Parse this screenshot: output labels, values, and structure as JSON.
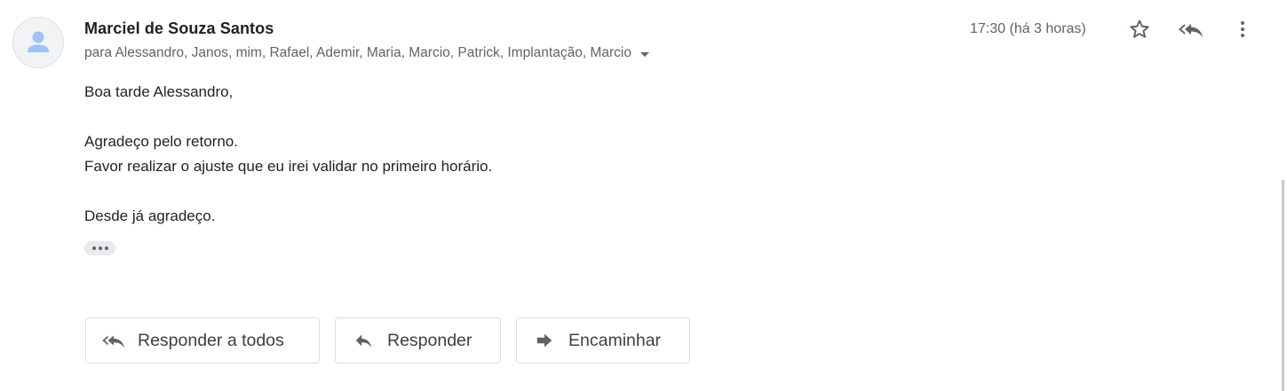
{
  "message": {
    "sender_name": "Marciel de Souza Santos",
    "recipients_text": "para Alessandro, Janos, mim, Rafael, Ademir, Maria, Marcio, Patrick, Implantação, Marcio",
    "timestamp": "17:30 (há 3 horas)",
    "body": {
      "greeting": "Boa tarde Alessandro,",
      "line1": "Agradeço pelo retorno.",
      "line2": "Favor realizar o ajuste que eu irei validar no primeiro horário.",
      "closing": "Desde já agradeço."
    }
  },
  "icons": {
    "avatar": "default-avatar-icon",
    "star": "star-outline-icon",
    "reply_all": "reply-all-icon",
    "more": "more-vert-icon",
    "recipients_toggle": "caret-down-icon",
    "show_trimmed": "ellipsis-icon",
    "reply": "reply-icon",
    "forward": "forward-icon"
  },
  "actions": {
    "reply_all_label": "Responder a todos",
    "reply_label": "Responder",
    "forward_label": "Encaminhar"
  },
  "colors": {
    "avatar_figure": "#9fc3f5",
    "icon_gray": "#5f6368",
    "button_border": "#dadce0"
  }
}
